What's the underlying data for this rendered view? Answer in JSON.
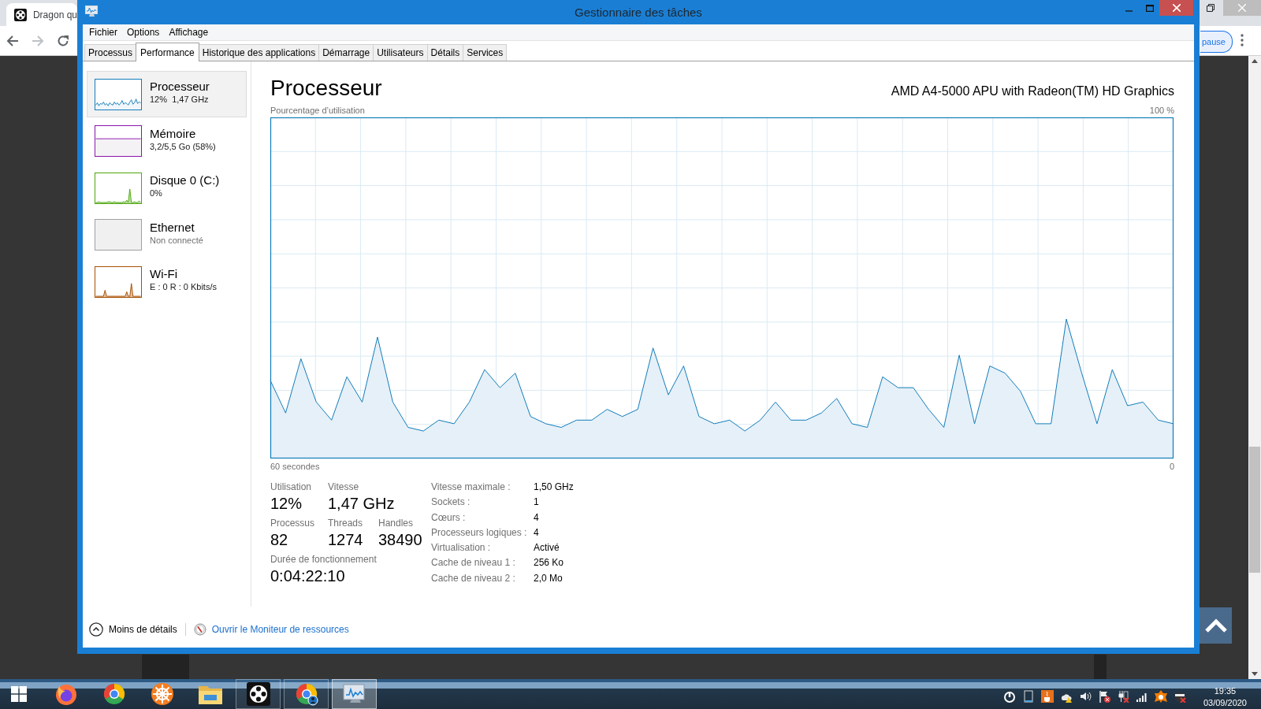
{
  "browser": {
    "tab_title": "Dragon qu",
    "toolbar_button": "pause"
  },
  "window": {
    "title": "Gestionnaire des tâches"
  },
  "menu": [
    "Fichier",
    "Options",
    "Affichage"
  ],
  "tabs": [
    {
      "label": "Processus",
      "selected": false
    },
    {
      "label": "Performance",
      "selected": true
    },
    {
      "label": "Historique des applications",
      "selected": false
    },
    {
      "label": "Démarrage",
      "selected": false
    },
    {
      "label": "Utilisateurs",
      "selected": false
    },
    {
      "label": "Détails",
      "selected": false
    },
    {
      "label": "Services",
      "selected": false
    }
  ],
  "sidebar": {
    "items": [
      {
        "kind": "noisy",
        "title": "Processeur",
        "subtitle": "12%  1,47 GHz",
        "color": "#117dbb",
        "selected": true,
        "connected": true
      },
      {
        "kind": "fill",
        "title": "Mémoire",
        "subtitle": "3,2/5,5 Go (58%)",
        "color": "#8b12ae",
        "selected": false,
        "connected": true
      },
      {
        "kind": "spikes",
        "title": "Disque 0 (C:)",
        "subtitle": "0%",
        "color": "#4da60c",
        "selected": false,
        "connected": true
      },
      {
        "kind": "blank",
        "title": "Ethernet",
        "subtitle": "Non connecté",
        "color": "#a0a0a0",
        "selected": false,
        "connected": false
      },
      {
        "kind": "spikes",
        "title": "Wi-Fi",
        "subtitle": "E : 0 R : 0 Kbits/s",
        "color": "#a74f01",
        "selected": false,
        "connected": true
      }
    ]
  },
  "detail": {
    "title": "Processeur",
    "device": "AMD A4-5000 APU with Radeon(TM) HD Graphics",
    "chart_data": {
      "type": "area",
      "ylabel": "Pourcentage d’utilisation",
      "xlabel": "60 secondes",
      "ylim": [
        0,
        100
      ],
      "grid": true,
      "yticks": [
        {
          "value": 0,
          "label": "0"
        },
        {
          "value": 100,
          "label": "100 %"
        }
      ],
      "series": [
        {
          "color": "#117dbb",
          "values": [
            24,
            15,
            30,
            18,
            13,
            25,
            18,
            36,
            18,
            11,
            10,
            13,
            12,
            18,
            27,
            22,
            26,
            14,
            12,
            11,
            13,
            13,
            16,
            14,
            16,
            33,
            20,
            28,
            14,
            12,
            13,
            10,
            13,
            18,
            13,
            13,
            15,
            19,
            12,
            11,
            25,
            22,
            22,
            16,
            11,
            31,
            12,
            28,
            26,
            21,
            12,
            12,
            41,
            26,
            12,
            27,
            17,
            18,
            13,
            12
          ]
        }
      ]
    },
    "stat_rows": [
      [
        {
          "label": "Utilisation",
          "value": "12%"
        },
        {
          "label": "Vitesse",
          "value": "1,47 GHz"
        }
      ],
      [
        {
          "label": "Processus",
          "value": "82"
        },
        {
          "label": "Threads",
          "value": "1274"
        },
        {
          "label": "Handles",
          "value": "38490"
        }
      ],
      [
        {
          "label": "Durée de fonctionnement",
          "value": "0:04:22:10"
        }
      ]
    ],
    "specs": [
      {
        "label": "Vitesse maximale :",
        "value": "1,50 GHz"
      },
      {
        "label": "Sockets :",
        "value": "1"
      },
      {
        "label": "Cœurs :",
        "value": "4"
      },
      {
        "label": "Processeurs logiques :",
        "value": "4"
      },
      {
        "label": "Virtualisation :",
        "value": "Activé"
      },
      {
        "label": "Cache de niveau 1 :",
        "value": "256 Ko"
      },
      {
        "label": "Cache de niveau 2 :",
        "value": "2,0 Mo"
      }
    ]
  },
  "footer": {
    "less_details": "Moins de détails",
    "link": "Ouvrir le Moniteur de ressources"
  },
  "taskbar": {
    "apps": [
      {
        "kind": "fox",
        "running": false,
        "selected": false
      },
      {
        "kind": "ring",
        "running": false,
        "selected": false
      },
      {
        "kind": "wheel",
        "running": false,
        "selected": false
      },
      {
        "kind": "folder",
        "running": false,
        "selected": false
      },
      {
        "kind": "emblem",
        "running": true,
        "selected": false
      },
      {
        "kind": "ring-badge",
        "running": true,
        "selected": false
      },
      {
        "kind": "monitor",
        "running": true,
        "selected": true
      }
    ],
    "clock": {
      "time": "19:35",
      "date": "03/09/2020"
    }
  }
}
